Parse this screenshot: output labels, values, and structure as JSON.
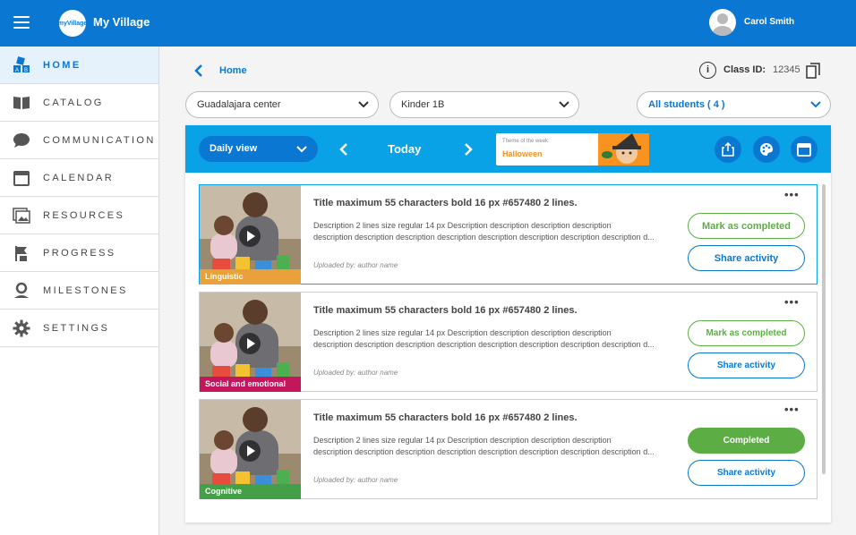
{
  "header": {
    "logo_text": "myVillage",
    "app_title": "My Village",
    "user_name": "Carol Smith"
  },
  "sidebar": {
    "items": [
      {
        "label": "HOME",
        "icon": "blocks-icon",
        "active": true
      },
      {
        "label": "CATALOG",
        "icon": "book-icon"
      },
      {
        "label": "COMMUNICATION",
        "icon": "chat-bubble-icon"
      },
      {
        "label": "CALENDAR",
        "icon": "calendar-icon"
      },
      {
        "label": "RESOURCES",
        "icon": "image-gallery-icon"
      },
      {
        "label": "PROGRESS",
        "icon": "flag-icon"
      },
      {
        "label": "MILESTONES",
        "icon": "map-pin-icon"
      },
      {
        "label": "SETTINGS",
        "icon": "gear-icon"
      }
    ]
  },
  "breadcrumb": {
    "label": "Home"
  },
  "class_info": {
    "label": "Class ID:",
    "value": "12345"
  },
  "filters": {
    "center": "Guadalajara center",
    "classroom": "Kinder 1B",
    "students": "All students ( 4 )"
  },
  "toolbar": {
    "view": "Daily view",
    "date": "Today",
    "theme_label": "Theme of the week:",
    "theme_value": "Halloween"
  },
  "activities": [
    {
      "category": "Linguistic",
      "category_color": "#e9a13b",
      "title": "Title maximum 55 characters bold 16 px #657480 2 lines.",
      "desc_line1": "Description 2 lines size regular 14 px Description description description description",
      "desc_line2": "description description description description description description description description d...",
      "author": "Uploaded by: author name",
      "status_label": "Mark as completed",
      "completed": false,
      "share_label": "Share activity"
    },
    {
      "category": "Social and emotional",
      "category_color": "#c2185b",
      "title": "Title maximum 55 characters bold 16 px #657480 2 lines.",
      "desc_line1": "Description 2 lines size regular 14 px Description description description description",
      "desc_line2": "description description description description description description description description d...",
      "author": "Uploaded by: author name",
      "status_label": "Mark as completed",
      "completed": false,
      "share_label": "Share activity"
    },
    {
      "category": "Cognitive",
      "category_color": "#43a047",
      "title": "Title maximum 55 characters bold 16 px #657480 2 lines.",
      "desc_line1": "Description 2 lines size regular 14 px Description description description description",
      "desc_line2": "description description description description description description description description d...",
      "author": "Uploaded by: author name",
      "status_label": "Completed",
      "completed": true,
      "share_label": "Share activity"
    }
  ],
  "colors": {
    "primary": "#0a78d2",
    "toolbar": "#0aa2e6",
    "success": "#5cae44"
  }
}
